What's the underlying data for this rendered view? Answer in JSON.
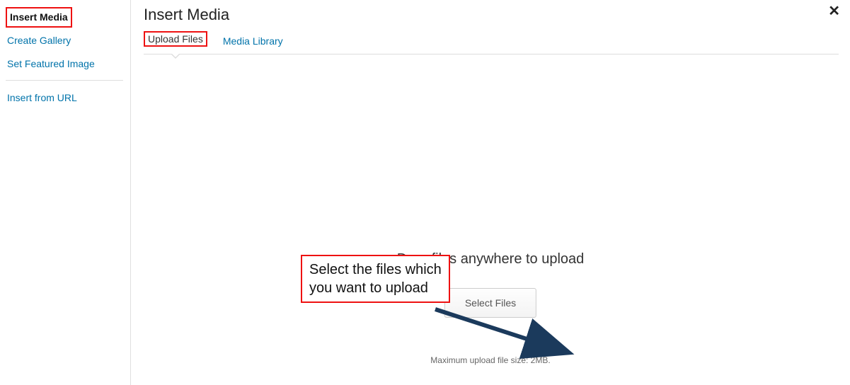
{
  "sidebar": {
    "items": [
      {
        "label": "Insert Media",
        "active": true,
        "highlighted": true
      },
      {
        "label": "Create Gallery"
      },
      {
        "label": "Set Featured Image"
      }
    ],
    "secondary": [
      {
        "label": "Insert from URL"
      }
    ]
  },
  "main": {
    "title": "Insert Media",
    "tabs": [
      {
        "label": "Upload Files",
        "active": true,
        "highlighted": true
      },
      {
        "label": "Media Library"
      }
    ],
    "drop_text": "Drop files anywhere to upload",
    "select_button": "Select Files",
    "max_size_text": "Maximum upload file size: 2MB."
  },
  "annotation": {
    "text": "Select the files which\nyou want to upload"
  }
}
